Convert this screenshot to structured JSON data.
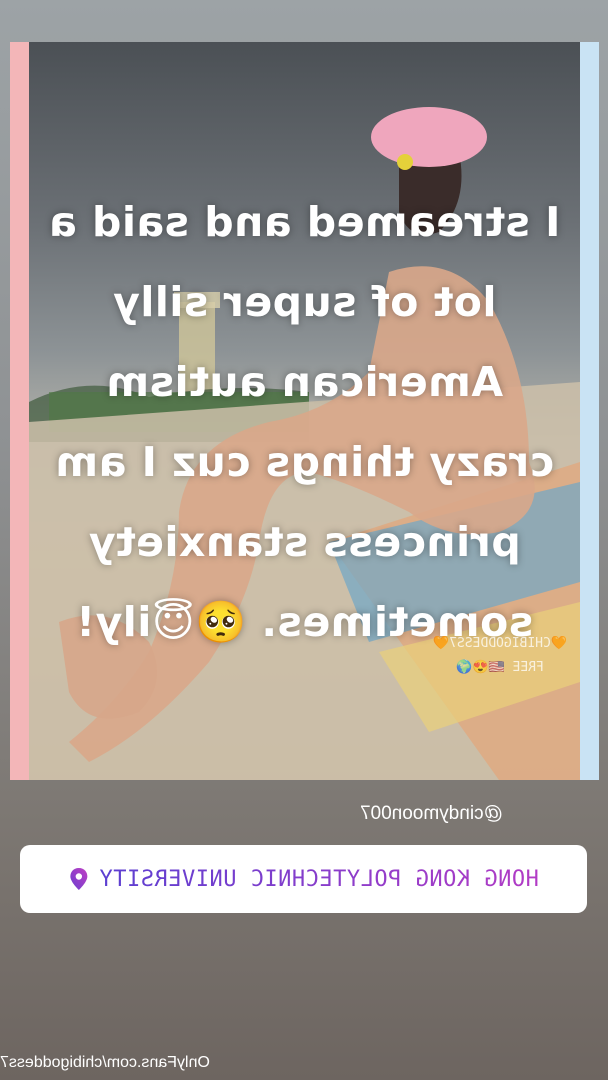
{
  "story": {
    "caption_lines": [
      "I streamed and said a",
      "lot of super silly",
      "American autism",
      "crazy things cuz I am",
      "princess stanxiety",
      "sometimes. 🥺😇ily!"
    ],
    "watermark": "🧡CHIBIGODDESS7🧡\nFREE 🇺🇸😍🌍",
    "username": "@cindymoon007",
    "location": "HONG KONG POLYTECHNIC UNIVERSITY",
    "source_url": "OnlyFans.com/chibigoddess7"
  },
  "icons": {
    "location": "map-pin-icon"
  },
  "colors": {
    "location_gradient_start": "#b23bc5",
    "location_gradient_end": "#5b3fd1"
  }
}
